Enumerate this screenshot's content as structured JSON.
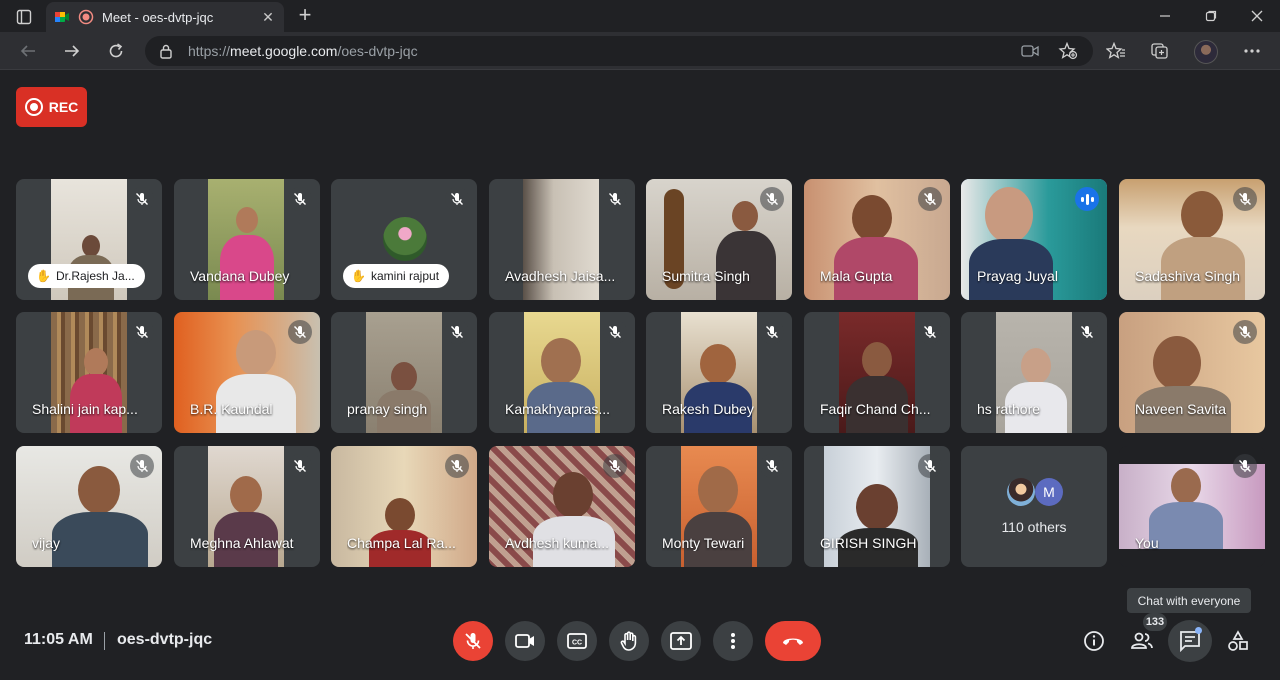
{
  "browser": {
    "tab_title": "Meet - oes-dvtp-jqc",
    "url_prefix": "https://",
    "url_host": "meet.google.com",
    "url_path": "/oes-dvtp-jqc"
  },
  "recording": {
    "label": "REC"
  },
  "participants": [
    {
      "name": "Dr.Rajesh Ja...",
      "hand_raised": true,
      "muted": true
    },
    {
      "name": "Vandana Dubey",
      "muted": true
    },
    {
      "name": "kamini rajput",
      "hand_raised": true,
      "muted": true,
      "avatar_only": true
    },
    {
      "name": "Avadhesh Jaisa...",
      "muted": true
    },
    {
      "name": "Sumitra Singh",
      "muted": true
    },
    {
      "name": "Mala Gupta",
      "muted": true
    },
    {
      "name": "Prayag Juyal",
      "speaking": true
    },
    {
      "name": "Sadashiva Singh",
      "muted": true
    },
    {
      "name": "Shalini jain kap...",
      "muted": true
    },
    {
      "name": "B.R. Kaundal",
      "muted": true
    },
    {
      "name": "pranay singh",
      "muted": true
    },
    {
      "name": "Kamakhyapras...",
      "muted": true
    },
    {
      "name": "Rakesh Dubey",
      "muted": true
    },
    {
      "name": "Faqir Chand Ch...",
      "muted": true
    },
    {
      "name": "hs rathore",
      "muted": true
    },
    {
      "name": "Naveen Savita",
      "muted": true
    },
    {
      "name": "vijay",
      "muted": true
    },
    {
      "name": "Meghna Ahlawat",
      "muted": true
    },
    {
      "name": "Champa Lal Ra...",
      "muted": true
    },
    {
      "name": "Avdhesh kuma...",
      "muted": true
    },
    {
      "name": "Monty Tewari",
      "muted": true
    },
    {
      "name": "GIRISH SINGH",
      "muted": true
    },
    {
      "name": "You",
      "muted": true
    }
  ],
  "others": {
    "avatar_letter": "M",
    "label": "110 others"
  },
  "meeting": {
    "time": "11:05 AM",
    "code": "oes-dvtp-jqc"
  },
  "side_panel": {
    "people_count": "133",
    "chat_tooltip": "Chat with everyone"
  },
  "colors": {
    "accent_blue": "#8ab4f8",
    "danger_red": "#ea4335",
    "tile_bg": "#3c4043",
    "page_bg": "#202124"
  }
}
